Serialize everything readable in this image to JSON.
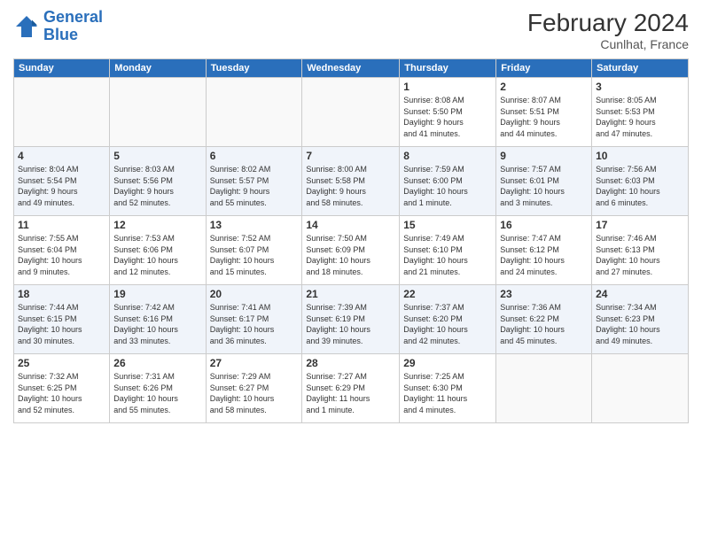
{
  "header": {
    "logo_line1": "General",
    "logo_line2": "Blue",
    "month": "February 2024",
    "location": "Cunlhat, France"
  },
  "weekdays": [
    "Sunday",
    "Monday",
    "Tuesday",
    "Wednesday",
    "Thursday",
    "Friday",
    "Saturday"
  ],
  "weeks": [
    [
      {
        "day": "",
        "info": ""
      },
      {
        "day": "",
        "info": ""
      },
      {
        "day": "",
        "info": ""
      },
      {
        "day": "",
        "info": ""
      },
      {
        "day": "1",
        "info": "Sunrise: 8:08 AM\nSunset: 5:50 PM\nDaylight: 9 hours\nand 41 minutes."
      },
      {
        "day": "2",
        "info": "Sunrise: 8:07 AM\nSunset: 5:51 PM\nDaylight: 9 hours\nand 44 minutes."
      },
      {
        "day": "3",
        "info": "Sunrise: 8:05 AM\nSunset: 5:53 PM\nDaylight: 9 hours\nand 47 minutes."
      }
    ],
    [
      {
        "day": "4",
        "info": "Sunrise: 8:04 AM\nSunset: 5:54 PM\nDaylight: 9 hours\nand 49 minutes."
      },
      {
        "day": "5",
        "info": "Sunrise: 8:03 AM\nSunset: 5:56 PM\nDaylight: 9 hours\nand 52 minutes."
      },
      {
        "day": "6",
        "info": "Sunrise: 8:02 AM\nSunset: 5:57 PM\nDaylight: 9 hours\nand 55 minutes."
      },
      {
        "day": "7",
        "info": "Sunrise: 8:00 AM\nSunset: 5:58 PM\nDaylight: 9 hours\nand 58 minutes."
      },
      {
        "day": "8",
        "info": "Sunrise: 7:59 AM\nSunset: 6:00 PM\nDaylight: 10 hours\nand 1 minute."
      },
      {
        "day": "9",
        "info": "Sunrise: 7:57 AM\nSunset: 6:01 PM\nDaylight: 10 hours\nand 3 minutes."
      },
      {
        "day": "10",
        "info": "Sunrise: 7:56 AM\nSunset: 6:03 PM\nDaylight: 10 hours\nand 6 minutes."
      }
    ],
    [
      {
        "day": "11",
        "info": "Sunrise: 7:55 AM\nSunset: 6:04 PM\nDaylight: 10 hours\nand 9 minutes."
      },
      {
        "day": "12",
        "info": "Sunrise: 7:53 AM\nSunset: 6:06 PM\nDaylight: 10 hours\nand 12 minutes."
      },
      {
        "day": "13",
        "info": "Sunrise: 7:52 AM\nSunset: 6:07 PM\nDaylight: 10 hours\nand 15 minutes."
      },
      {
        "day": "14",
        "info": "Sunrise: 7:50 AM\nSunset: 6:09 PM\nDaylight: 10 hours\nand 18 minutes."
      },
      {
        "day": "15",
        "info": "Sunrise: 7:49 AM\nSunset: 6:10 PM\nDaylight: 10 hours\nand 21 minutes."
      },
      {
        "day": "16",
        "info": "Sunrise: 7:47 AM\nSunset: 6:12 PM\nDaylight: 10 hours\nand 24 minutes."
      },
      {
        "day": "17",
        "info": "Sunrise: 7:46 AM\nSunset: 6:13 PM\nDaylight: 10 hours\nand 27 minutes."
      }
    ],
    [
      {
        "day": "18",
        "info": "Sunrise: 7:44 AM\nSunset: 6:15 PM\nDaylight: 10 hours\nand 30 minutes."
      },
      {
        "day": "19",
        "info": "Sunrise: 7:42 AM\nSunset: 6:16 PM\nDaylight: 10 hours\nand 33 minutes."
      },
      {
        "day": "20",
        "info": "Sunrise: 7:41 AM\nSunset: 6:17 PM\nDaylight: 10 hours\nand 36 minutes."
      },
      {
        "day": "21",
        "info": "Sunrise: 7:39 AM\nSunset: 6:19 PM\nDaylight: 10 hours\nand 39 minutes."
      },
      {
        "day": "22",
        "info": "Sunrise: 7:37 AM\nSunset: 6:20 PM\nDaylight: 10 hours\nand 42 minutes."
      },
      {
        "day": "23",
        "info": "Sunrise: 7:36 AM\nSunset: 6:22 PM\nDaylight: 10 hours\nand 45 minutes."
      },
      {
        "day": "24",
        "info": "Sunrise: 7:34 AM\nSunset: 6:23 PM\nDaylight: 10 hours\nand 49 minutes."
      }
    ],
    [
      {
        "day": "25",
        "info": "Sunrise: 7:32 AM\nSunset: 6:25 PM\nDaylight: 10 hours\nand 52 minutes."
      },
      {
        "day": "26",
        "info": "Sunrise: 7:31 AM\nSunset: 6:26 PM\nDaylight: 10 hours\nand 55 minutes."
      },
      {
        "day": "27",
        "info": "Sunrise: 7:29 AM\nSunset: 6:27 PM\nDaylight: 10 hours\nand 58 minutes."
      },
      {
        "day": "28",
        "info": "Sunrise: 7:27 AM\nSunset: 6:29 PM\nDaylight: 11 hours\nand 1 minute."
      },
      {
        "day": "29",
        "info": "Sunrise: 7:25 AM\nSunset: 6:30 PM\nDaylight: 11 hours\nand 4 minutes."
      },
      {
        "day": "",
        "info": ""
      },
      {
        "day": "",
        "info": ""
      }
    ]
  ]
}
